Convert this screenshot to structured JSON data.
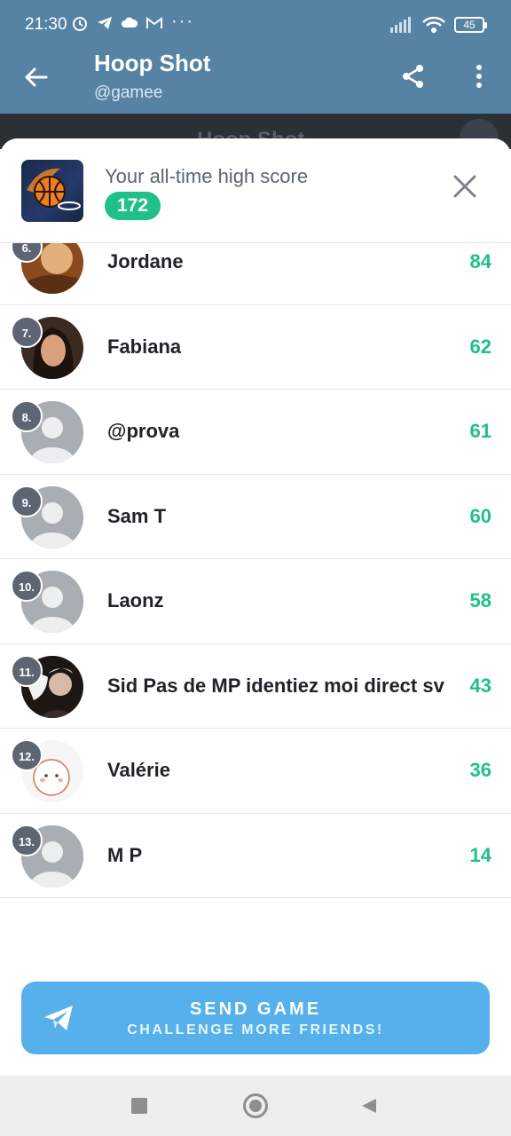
{
  "status_bar": {
    "time": "21:30",
    "dots": "···",
    "battery": "45"
  },
  "appbar": {
    "title": "Hoop Shot",
    "subtitle": "@gamee"
  },
  "behind": {
    "title": "Hoop Shot"
  },
  "header": {
    "high_score_label": "Your all-time high score",
    "high_score": "172"
  },
  "leaderboard": [
    {
      "rank": "6.",
      "name": "Jordane",
      "score": "84",
      "avatar": "photo"
    },
    {
      "rank": "7.",
      "name": "Fabiana",
      "score": "62",
      "avatar": "photo"
    },
    {
      "rank": "8.",
      "name": "@prova",
      "score": "61",
      "avatar": "default"
    },
    {
      "rank": "9.",
      "name": "Sam T",
      "score": "60",
      "avatar": "default"
    },
    {
      "rank": "10.",
      "name": "Laonz",
      "score": "58",
      "avatar": "default"
    },
    {
      "rank": "11.",
      "name": "Sid Pas de MP identiez moi direct sv",
      "score": "43",
      "avatar": "photo"
    },
    {
      "rank": "12.",
      "name": "Valérie",
      "score": "36",
      "avatar": "sticker"
    },
    {
      "rank": "13.",
      "name": "M P",
      "score": "14",
      "avatar": "default"
    }
  ],
  "send_button": {
    "line1": "SEND GAME",
    "line2": "CHALLENGE MORE FRIENDS!"
  },
  "colors": {
    "appbar": "#5682a3",
    "accent_green": "#1fc08a",
    "send_blue": "#55b0eb"
  },
  "icons": {
    "back": "arrow-left-icon",
    "share": "share-icon",
    "more": "more-vertical-icon",
    "close": "close-icon",
    "send": "paper-plane-icon"
  }
}
